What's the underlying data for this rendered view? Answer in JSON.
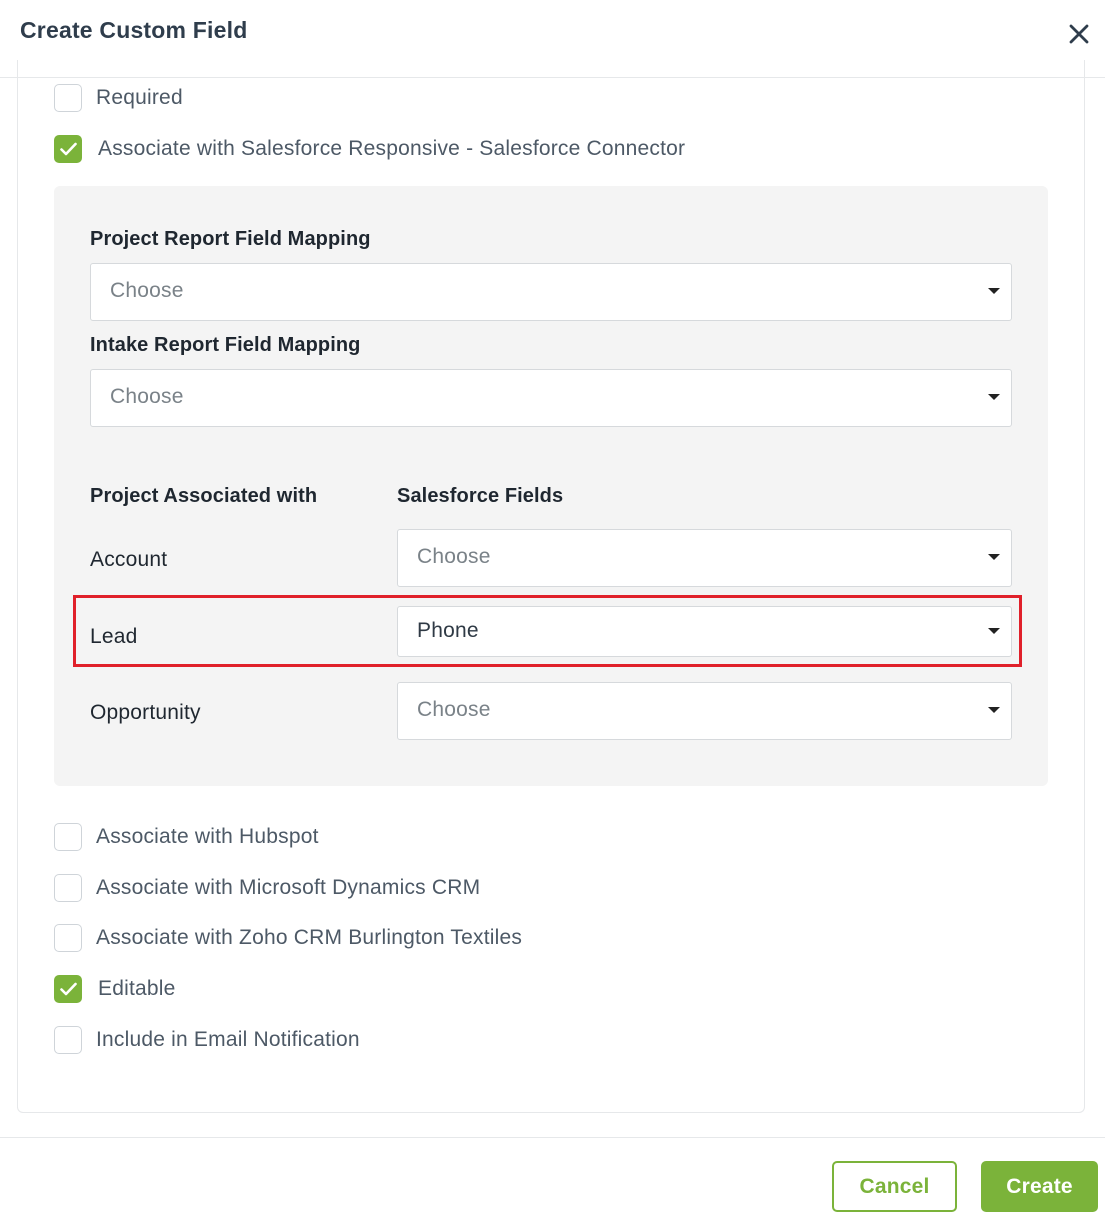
{
  "dialog": {
    "title": "Create Custom Field"
  },
  "options": {
    "required": {
      "label": "Required",
      "checked": false
    },
    "salesforce": {
      "label": "Associate with Salesforce Responsive - Salesforce Connector",
      "checked": true
    },
    "hubspot": {
      "label": "Associate with Hubspot",
      "checked": false
    },
    "dynamics": {
      "label": "Associate with Microsoft Dynamics CRM",
      "checked": false
    },
    "zoho": {
      "label": "Associate with Zoho CRM Burlington Textiles",
      "checked": false
    },
    "editable": {
      "label": "Editable",
      "checked": true
    },
    "email": {
      "label": "Include in Email Notification",
      "checked": false
    }
  },
  "salesforce_panel": {
    "project_report": {
      "label": "Project Report Field Mapping",
      "value": "Choose"
    },
    "intake_report": {
      "label": "Intake Report Field Mapping",
      "value": "Choose"
    },
    "columns": {
      "left": "Project Associated with",
      "right": "Salesforce Fields"
    },
    "rows": [
      {
        "label": "Account",
        "value": "Choose",
        "selected": false
      },
      {
        "label": "Lead",
        "value": "Phone",
        "selected": true
      },
      {
        "label": "Opportunity",
        "value": "Choose",
        "selected": false
      }
    ]
  },
  "footer": {
    "cancel_label": "Cancel",
    "create_label": "Create"
  },
  "colors": {
    "accent": "#7bb33a",
    "highlight": "#e0202a",
    "panel_bg": "#f4f4f4"
  },
  "icons": {
    "close": "close-icon",
    "check": "checkmark-icon",
    "dropdown": "caret-down-icon"
  }
}
